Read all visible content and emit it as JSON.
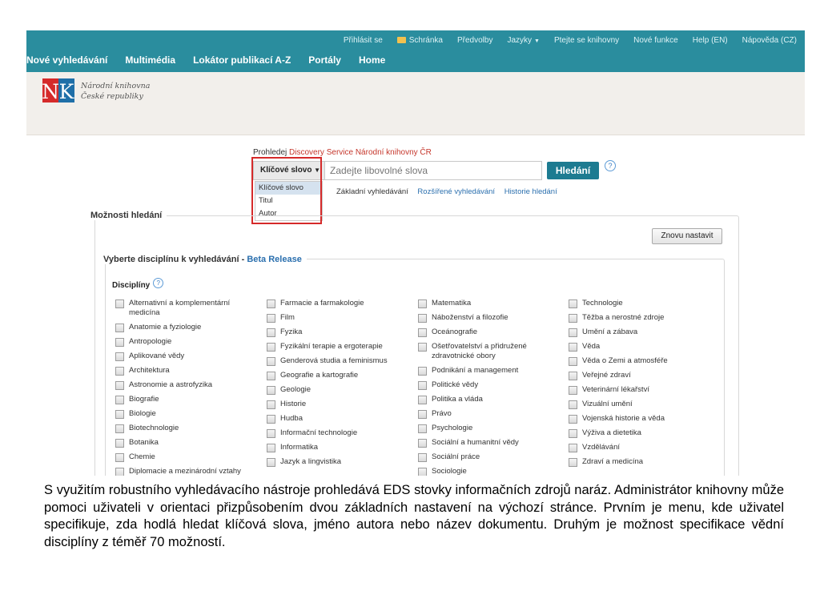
{
  "topbar": {
    "util_links": [
      "Přihlásit se",
      "Schránka",
      "Předvolby",
      "Jazyky",
      "Ptejte se knihovny",
      "Nové funkce",
      "Help (EN)",
      "Nápověda (CZ)"
    ],
    "main_nav": [
      "Nové vyhledávání",
      "Multimédia",
      "Lokátor publikací A-Z",
      "Portály",
      "Home"
    ]
  },
  "branding": {
    "logo_letters": "NK",
    "name_line1": "Národní knihovna",
    "name_line2": "České republiky"
  },
  "search": {
    "title_prefix": "Prohledej ",
    "title_brand": "Discovery Service Národní knihovny ČR",
    "mode_selected": "Klíčové slovo",
    "placeholder": "Zadejte libovolné slova",
    "button": "Hledání",
    "help": "?",
    "mode_options": [
      "Klíčové slovo",
      "Titul",
      "Autor"
    ],
    "links": [
      "Základní vyhledávání",
      "Rozšířené vyhledávání",
      "Historie hledání"
    ]
  },
  "options": {
    "label": "Možnosti hledání",
    "reset": "Znovu nastavit",
    "discipline_legend": "Vyberte disciplínu k vyhledávání - ",
    "beta": "Beta Release",
    "disciplines_heading": "Disciplíny",
    "columns": [
      [
        "Alternativní a komplementární medicína",
        "Anatomie a fyziologie",
        "Antropologie",
        "Aplikované vědy",
        "Architektura",
        "Astronomie a astrofyzika",
        "Biografie",
        "Biologie",
        "Biotechnologie",
        "Botanika",
        "Chemie",
        "Diplomacie a mezinárodní vztahy"
      ],
      [
        "Farmacie a farmakologie",
        "Film",
        "Fyzika",
        "Fyzikální terapie a ergoterapie",
        "Genderová studia a feminismus",
        "Geografie a kartografie",
        "Geologie",
        "Historie",
        "Hudba",
        "Informační technologie",
        "Informatika",
        "Jazyk a lingvistika"
      ],
      [
        "Matematika",
        "Náboženství a filozofie",
        "Oceánografie",
        "Ošetřovatelství a přidružené zdravotnické obory",
        "Podnikání a management",
        "Politické vědy",
        "Politika a vláda",
        "Právo",
        "Psychologie",
        "Sociální a humanitní vědy",
        "Sociální práce",
        "Sociologie"
      ],
      [
        "Technologie",
        "Těžba a nerostné zdroje",
        "Umění a zábava",
        "Věda",
        "Věda o Zemi a atmosféře",
        "Veřejné zdraví",
        "Veterinární lékařství",
        "Vizuální umění",
        "Vojenská historie a věda",
        "Výživa a dietetika",
        "Vzdělávání",
        "Zdraví a medicína"
      ]
    ]
  },
  "caption": "S využitím robustního vyhledávacího nástroje prohledává EDS stovky informačních zdrojů naráz. Administrátor knihovny může pomoci uživateli v orientaci přizpůsobením dvou základních nastavení na výchozí stránce. Prvním je menu, kde uživatel specifikuje, zda hodlá hledat klíčová slova, jméno autora nebo název dokumentu. Druhým je možnost specifikace vědní disciplíny z téměř 70 možností.",
  "colors": {
    "topbar": "#2a8d9e",
    "highlight": "#d52a2a",
    "search_button": "#1d7b91",
    "brand_red": "#d52a2a",
    "brand_blue": "#1f6fa8"
  }
}
